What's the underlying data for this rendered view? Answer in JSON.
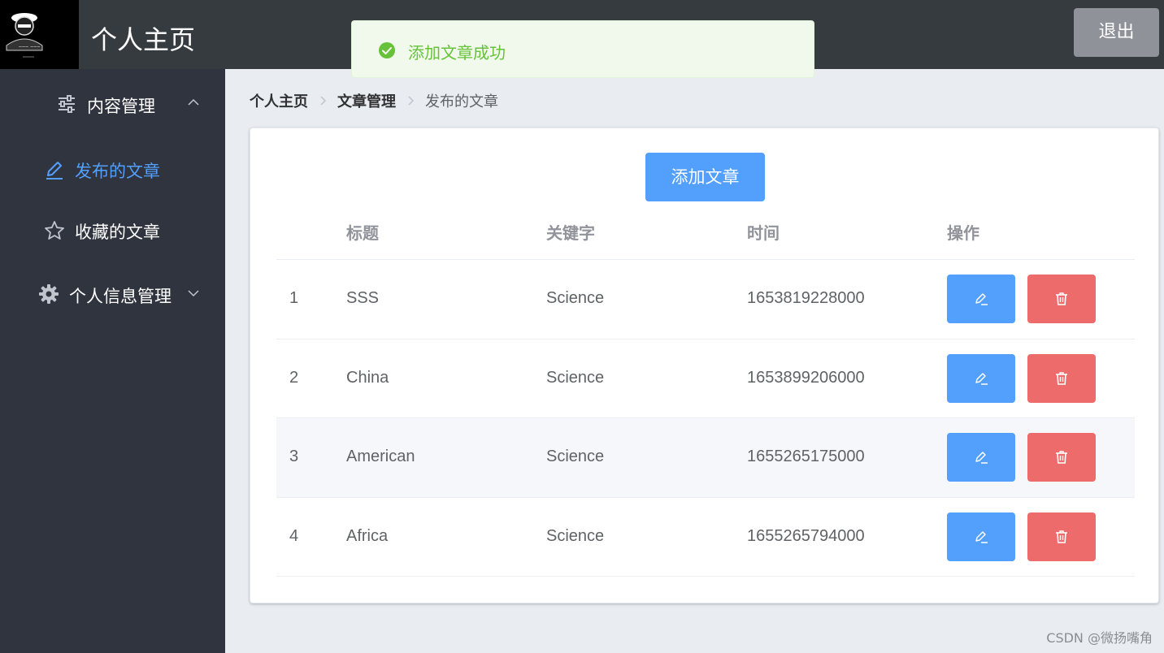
{
  "header": {
    "title": "个人主页",
    "logout_label": "退出"
  },
  "toast": {
    "message": "添加文章成功",
    "icon": "check-circle-icon",
    "color": "#67c23a"
  },
  "sidebar": {
    "items": [
      {
        "label": "内容管理",
        "icon": "sliders-icon",
        "arrow": "chevron-up-icon"
      },
      {
        "label": "发布的文章",
        "icon": "edit-pen-icon",
        "active": true
      },
      {
        "label": "收藏的文章",
        "icon": "star-icon"
      },
      {
        "label": "个人信息管理",
        "icon": "gear-icon",
        "arrow": "chevron-down-icon"
      }
    ],
    "active_color": "#529ffc"
  },
  "breadcrumb": [
    "个人主页",
    "文章管理",
    "发布的文章"
  ],
  "main": {
    "add_button_label": "添加文章",
    "table": {
      "columns": [
        "",
        "标题",
        "关键字",
        "时间",
        "操作"
      ],
      "rows": [
        {
          "index": "1",
          "title": "SSS",
          "keyword": "Science",
          "time": "1653819228000"
        },
        {
          "index": "2",
          "title": "China",
          "keyword": "Science",
          "time": "1653899206000"
        },
        {
          "index": "3",
          "title": "American",
          "keyword": "Science",
          "time": "1655265175000"
        },
        {
          "index": "4",
          "title": "Africa",
          "keyword": "Science",
          "time": "1655265794000"
        }
      ]
    }
  },
  "watermark": "CSDN @微扬嘴角"
}
